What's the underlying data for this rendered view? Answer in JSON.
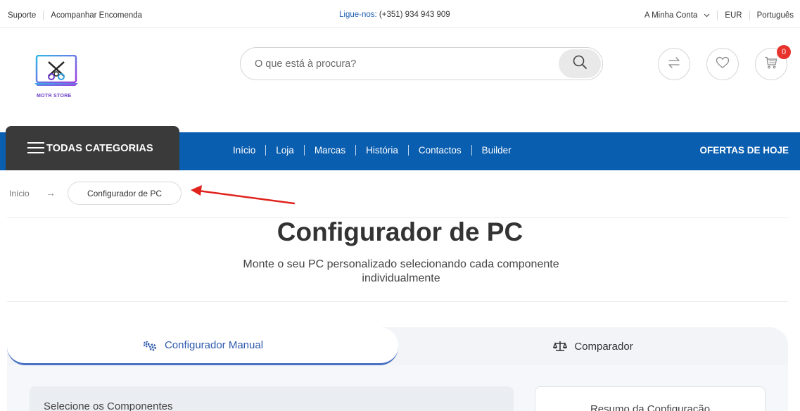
{
  "topbar": {
    "support": "Suporte",
    "track_order": "Acompanhar Encomenda",
    "call_label": "Ligue-nos:",
    "phone": "(+351) 934 943 909",
    "my_account": "A Minha Conta",
    "currency": "EUR",
    "language": "Português"
  },
  "header": {
    "logo_text": "MOTR STORE",
    "search_placeholder": "O que está à procura?",
    "cart_count": "0"
  },
  "nav": {
    "all_categories": "TODAS CATEGORIAS",
    "items": [
      "Início",
      "Loja",
      "Marcas",
      "História",
      "Contactos",
      "Builder"
    ],
    "offers": "OFERTAS DE HOJE"
  },
  "breadcrumb": {
    "home": "Início",
    "arrow": "→",
    "current": "Configurador de PC"
  },
  "page": {
    "title": "Configurador de PC",
    "subtitle": "Monte o seu PC personalizado selecionando cada componente individualmente"
  },
  "tabs": {
    "manual": "Configurador Manual",
    "compare": "Comparador"
  },
  "panels": {
    "components_title": "Selecione os Componentes",
    "summary_title": "Resumo da Configuração"
  },
  "colors": {
    "nav_blue": "#0a5eb0",
    "categories_dark": "#3a3a3a",
    "link_blue": "#1f5fb4",
    "badge_red": "#e8332c",
    "annotation_red": "#e0231d"
  }
}
